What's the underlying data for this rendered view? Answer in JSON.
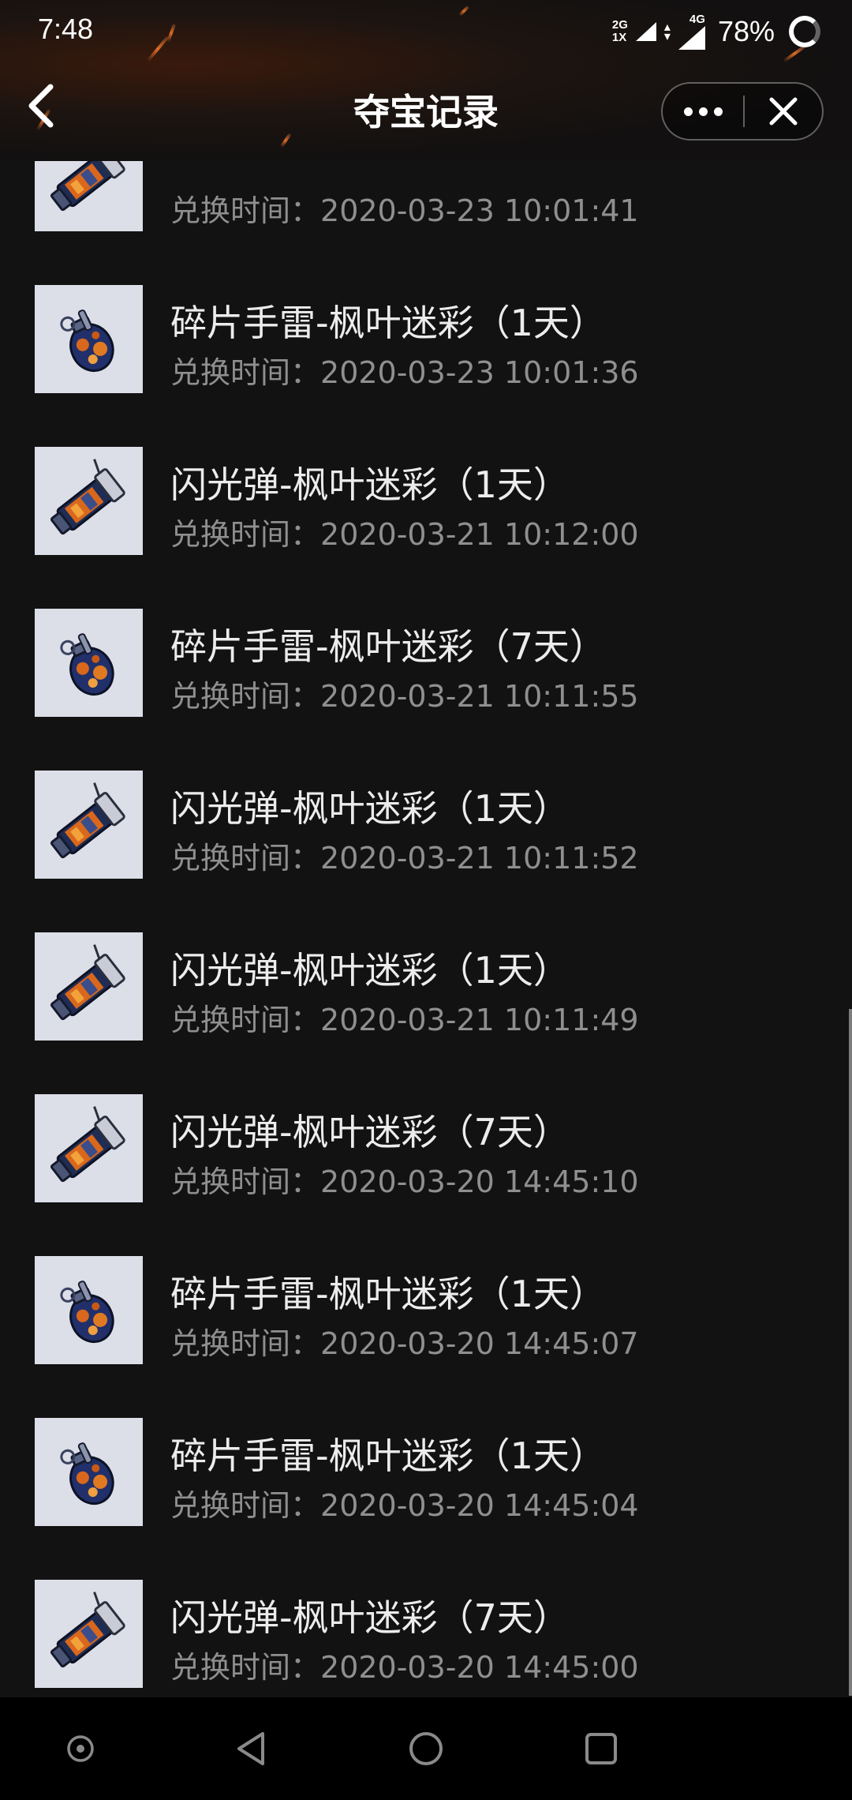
{
  "status_bar": {
    "time": "7:48",
    "network_1": {
      "top": "2G",
      "bottom": "1X"
    },
    "network_2": "4G",
    "battery": "78%"
  },
  "nav": {
    "title": "夺宝记录",
    "back_icon": "chevron-left-icon",
    "more_icon": "more-dots-icon",
    "close_icon": "close-icon"
  },
  "records": [
    {
      "name": "",
      "time_label": "兑换时间：",
      "time": "2020-03-23 10:01:41",
      "icon": "flashbang"
    },
    {
      "name": "碎片手雷-枫叶迷彩（1天）",
      "time_label": "兑换时间：",
      "time": "2020-03-23 10:01:36",
      "icon": "grenade"
    },
    {
      "name": "闪光弹-枫叶迷彩（1天）",
      "time_label": "兑换时间：",
      "time": "2020-03-21 10:12:00",
      "icon": "flashbang"
    },
    {
      "name": "碎片手雷-枫叶迷彩（7天）",
      "time_label": "兑换时间：",
      "time": "2020-03-21 10:11:55",
      "icon": "grenade"
    },
    {
      "name": "闪光弹-枫叶迷彩（1天）",
      "time_label": "兑换时间：",
      "time": "2020-03-21 10:11:52",
      "icon": "flashbang"
    },
    {
      "name": "闪光弹-枫叶迷彩（1天）",
      "time_label": "兑换时间：",
      "time": "2020-03-21 10:11:49",
      "icon": "flashbang"
    },
    {
      "name": "闪光弹-枫叶迷彩（7天）",
      "time_label": "兑换时间：",
      "time": "2020-03-20 14:45:10",
      "icon": "flashbang"
    },
    {
      "name": "碎片手雷-枫叶迷彩（1天）",
      "time_label": "兑换时间：",
      "time": "2020-03-20 14:45:07",
      "icon": "grenade"
    },
    {
      "name": "碎片手雷-枫叶迷彩（1天）",
      "time_label": "兑换时间：",
      "time": "2020-03-20 14:45:04",
      "icon": "grenade"
    },
    {
      "name": "闪光弹-枫叶迷彩（7天）",
      "time_label": "兑换时间：",
      "time": "2020-03-20 14:45:00",
      "icon": "flashbang"
    }
  ],
  "system_nav": {
    "buttons": [
      "assistant-icon",
      "back-triangle-icon",
      "home-circle-icon",
      "recents-square-icon"
    ]
  }
}
